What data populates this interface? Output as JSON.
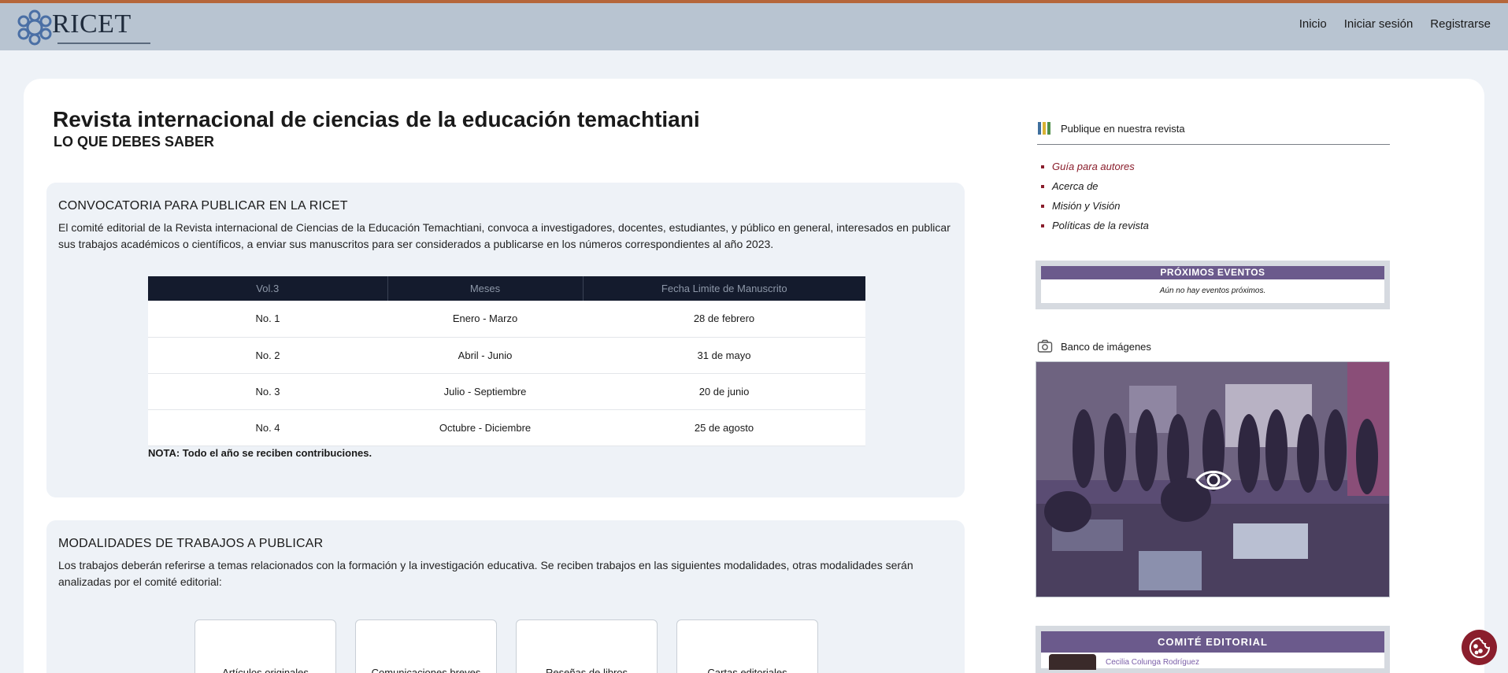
{
  "header": {
    "logo_text": "RICET",
    "nav": [
      "Inicio",
      "Iniciar sesión",
      "Registrarse"
    ]
  },
  "main": {
    "title": "Revista internacional de ciencias de la educación temachtiani",
    "subtitle": "LO QUE DEBES SABER",
    "convocatoria": {
      "title": "CONVOCATORIA PARA PUBLICAR EN LA RICET",
      "text": "El comité editorial de la Revista internacional de Ciencias de la Educación Temachtiani, convoca a investigadores, docentes, estudiantes, y público en general, interesados en publicar sus trabajos académicos o científicos, a enviar sus manuscritos para ser considerados a publicarse en los números correspondientes al año 2023.",
      "columns": [
        "Vol.3",
        "Meses",
        "Fecha Limite de Manuscrito"
      ],
      "rows": [
        [
          "No. 1",
          "Enero - Marzo",
          "28 de febrero"
        ],
        [
          "No. 2",
          "Abril - Junio",
          "31 de mayo"
        ],
        [
          "No. 3",
          "Julio - Septiembre",
          "20 de junio"
        ],
        [
          "No. 4",
          "Octubre - Diciembre",
          "25 de agosto"
        ]
      ],
      "nota": "NOTA: Todo el año se reciben contribuciones."
    },
    "modalidades": {
      "title": "MODALIDADES DE TRABAJOS A PUBLICAR",
      "text": "Los trabajos deberán referirse a temas relacionados con la formación y la investigación educativa. Se reciben trabajos en las siguientes modalidades, otras modalidades serán analizadas por el comité editorial:",
      "items": [
        "Artículos originales",
        "Comunicaciones breves",
        "Reseñas de libros",
        "Cartas editoriales"
      ]
    }
  },
  "sidebar": {
    "publique_title": "Publique en nuestra revista",
    "links": [
      "Guía para autores",
      "Acerca de",
      "Misión y Visión",
      "Políticas de la revista"
    ],
    "events_title": "PRÓXIMOS EVENTOS",
    "events_empty": "Aún no hay eventos próximos.",
    "banco_title": "Banco de imágenes",
    "comite_title": "COMITÉ EDITORIAL",
    "comite_first": "Cecilia Colunga Rodríguez"
  },
  "icons": [
    "logo-emblem-icon",
    "bars-chart-icon",
    "camera-icon",
    "eye-icon",
    "cookie-icon"
  ],
  "colors": {
    "header_bg": "#b8c4d1",
    "table_header_bg": "#141b2d",
    "accent_purple": "#6b5a8c",
    "link_active": "#8a1e2c"
  }
}
